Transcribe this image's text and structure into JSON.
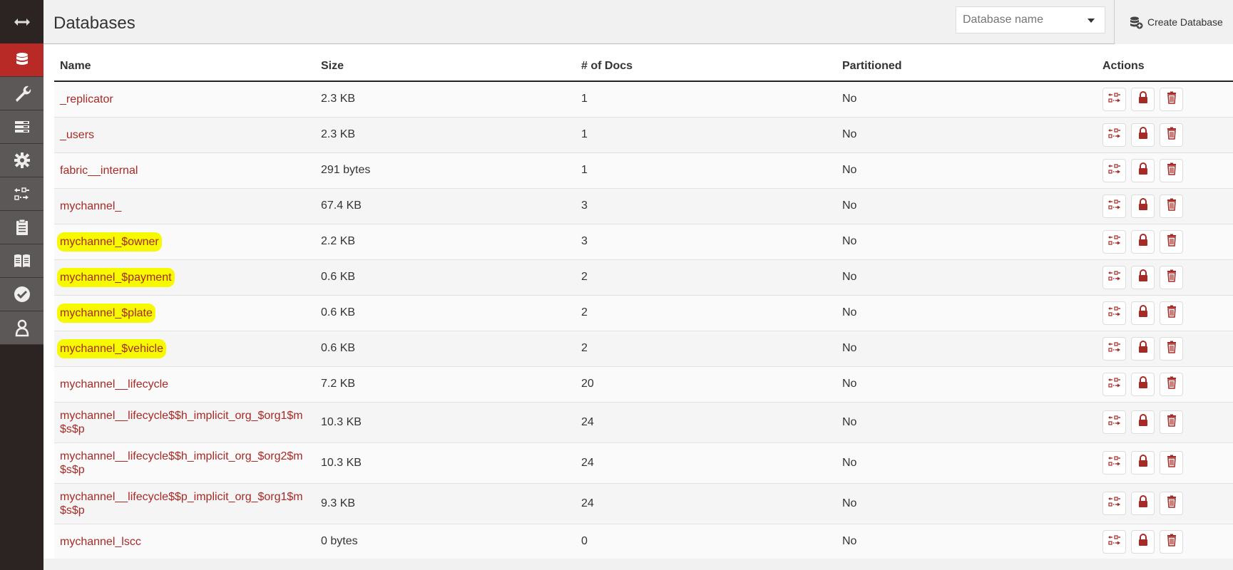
{
  "header": {
    "title": "Databases",
    "search_placeholder": "Database name",
    "create_label": "Create Database"
  },
  "sidebar": {
    "items": [
      {
        "name": "toggle",
        "icon": "double-arrow-icon"
      },
      {
        "name": "databases",
        "icon": "database-icon",
        "active": true
      },
      {
        "name": "setup",
        "icon": "wrench-icon"
      },
      {
        "name": "active-tasks",
        "icon": "tasks-icon"
      },
      {
        "name": "config",
        "icon": "gear-icon"
      },
      {
        "name": "replication",
        "icon": "replication-icon"
      },
      {
        "name": "logs",
        "icon": "clipboard-icon"
      },
      {
        "name": "documentation",
        "icon": "book-icon"
      },
      {
        "name": "verify",
        "icon": "check-circle-icon"
      },
      {
        "name": "user",
        "icon": "user-icon"
      }
    ]
  },
  "table": {
    "headers": {
      "name": "Name",
      "size": "Size",
      "docs": "# of Docs",
      "partitioned": "Partitioned",
      "actions": "Actions"
    },
    "rows": [
      {
        "name": "_replicator",
        "size": "2.3 KB",
        "docs": "1",
        "partitioned": "No",
        "highlight": false
      },
      {
        "name": "_users",
        "size": "2.3 KB",
        "docs": "1",
        "partitioned": "No",
        "highlight": false
      },
      {
        "name": "fabric__internal",
        "size": "291 bytes",
        "docs": "1",
        "partitioned": "No",
        "highlight": false
      },
      {
        "name": "mychannel_",
        "size": "67.4 KB",
        "docs": "3",
        "partitioned": "No",
        "highlight": false
      },
      {
        "name": "mychannel_$owner",
        "size": "2.2 KB",
        "docs": "3",
        "partitioned": "No",
        "highlight": true
      },
      {
        "name": "mychannel_$payment",
        "size": "0.6 KB",
        "docs": "2",
        "partitioned": "No",
        "highlight": true
      },
      {
        "name": "mychannel_$plate",
        "size": "0.6 KB",
        "docs": "2",
        "partitioned": "No",
        "highlight": true
      },
      {
        "name": "mychannel_$vehicle",
        "size": "0.6 KB",
        "docs": "2",
        "partitioned": "No",
        "highlight": true
      },
      {
        "name": "mychannel__lifecycle",
        "size": "7.2 KB",
        "docs": "20",
        "partitioned": "No",
        "highlight": false
      },
      {
        "name": "mychannel__lifecycle$$h_implicit_org_$org1$m$s$p",
        "size": "10.3 KB",
        "docs": "24",
        "partitioned": "No",
        "highlight": false
      },
      {
        "name": "mychannel__lifecycle$$h_implicit_org_$org2$m$s$p",
        "size": "10.3 KB",
        "docs": "24",
        "partitioned": "No",
        "highlight": false
      },
      {
        "name": "mychannel__lifecycle$$p_implicit_org_$org1$m$s$p",
        "size": "9.3 KB",
        "docs": "24",
        "partitioned": "No",
        "highlight": false
      },
      {
        "name": "mychannel_lscc",
        "size": "0 bytes",
        "docs": "0",
        "partitioned": "No",
        "highlight": false
      }
    ]
  },
  "colors": {
    "accent": "#b82a26",
    "link": "#a62a26",
    "highlight": "#f6f900",
    "sidebar": "#2c2423"
  }
}
